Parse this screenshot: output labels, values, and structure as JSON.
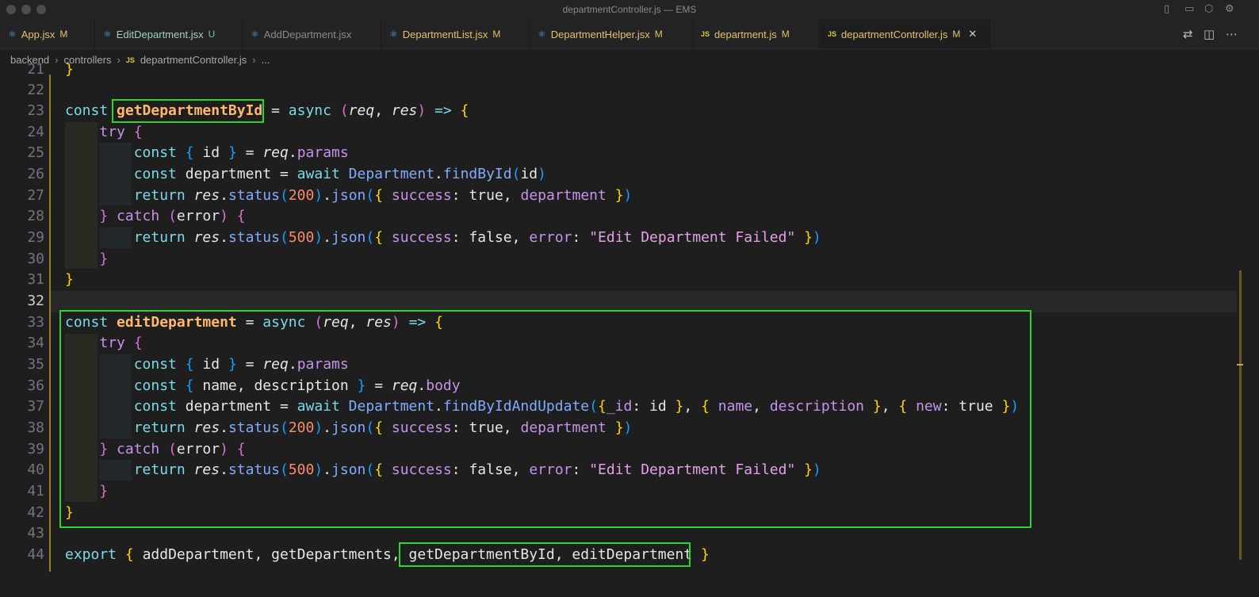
{
  "window": {
    "title": "departmentController.js — EMS"
  },
  "tabs": [
    {
      "label": "App.jsx",
      "badge": "M",
      "icon": "react-icon"
    },
    {
      "label": "EditDepartment.jsx",
      "badge": "U",
      "icon": "react-icon"
    },
    {
      "label": "AddDepartment.jsx",
      "badge": "",
      "icon": "react-icon"
    },
    {
      "label": "DepartmentList.jsx",
      "badge": "M",
      "icon": "react-icon"
    },
    {
      "label": "DepartmentHelper.jsx",
      "badge": "M",
      "icon": "react-icon"
    },
    {
      "label": "department.js",
      "badge": "M",
      "icon": "js-icon"
    },
    {
      "label": "departmentController.js",
      "badge": "M",
      "icon": "js-icon"
    }
  ],
  "js_icon_text": "JS",
  "breadcrumb": {
    "items": [
      "backend",
      "controllers",
      "departmentController.js",
      "..."
    ]
  },
  "editor": {
    "line_numbers": [
      "22",
      "23",
      "24",
      "25",
      "26",
      "27",
      "28",
      "29",
      "30",
      "31",
      "32",
      "33",
      "34",
      "35",
      "36",
      "37",
      "38",
      "39",
      "40",
      "41",
      "42",
      "43",
      "44"
    ],
    "current_line": "32",
    "partial_line_number": "21",
    "partial_line_text": "}",
    "lines": [
      "",
      "const getDepartmentById = async (req, res) => {",
      "    try {",
      "        const { id } = req.params",
      "        const department = await Department.findById(id)",
      "        return res.status(200).json({ success: true, department })",
      "    } catch (error) {",
      "        return res.status(500).json({ success: false, error: \"Edit Department Failed\" })",
      "    }",
      "}",
      "",
      "const editDepartment = async (req, res) => {",
      "    try {",
      "        const { id } = req.params",
      "        const { name, description } = req.body",
      "        const department = await Department.findByIdAndUpdate({_id: id }, { name, description }, { new: true })",
      "        return res.status(200).json({ success: true, department })",
      "    } catch (error) {",
      "        return res.status(500).json({ success: false, error: \"Edit Department Failed\" })",
      "    }",
      "}",
      "",
      "export { addDepartment, getDepartments, getDepartmentById, editDepartment }"
    ]
  },
  "colors": {
    "highlight_box": "#2ed52e",
    "editor_bg": "#1e1e1e"
  }
}
